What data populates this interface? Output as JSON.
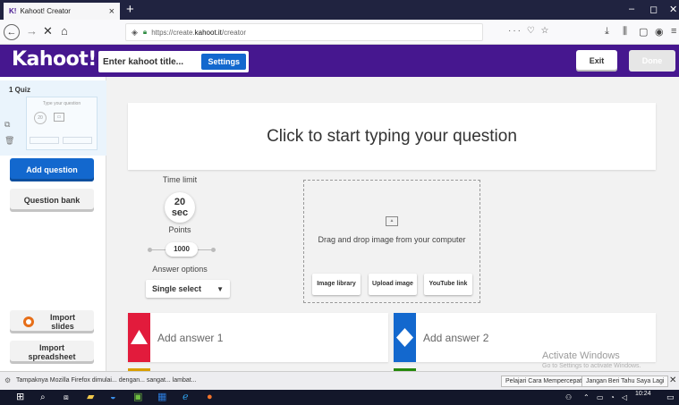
{
  "browser": {
    "tab_title": "Kahoot! Creator",
    "tab_favicon": "K!",
    "tab_close": "×",
    "new_tab": "+",
    "url_host": "https://create.",
    "url_domain": "kahoot.it",
    "url_path": "/creator",
    "page_actions": "··· ♡ ☆",
    "win_min": "‒",
    "win_max": "◻",
    "win_close": "✕"
  },
  "header": {
    "logo": "Kahoot!",
    "title_placeholder": "Enter kahoot title...",
    "settings_label": "Settings",
    "exit_label": "Exit",
    "done_label": "Done"
  },
  "sidebar": {
    "quiz_label": "1 Quiz",
    "thumb_question": "Type your question",
    "thumb_circle": "20",
    "add_question": "Add question",
    "question_bank": "Question bank",
    "import_slides": "Import slides",
    "import_spreadsheet": "Import spreadsheet"
  },
  "question": {
    "placeholder": "Click to start typing your question"
  },
  "options": {
    "time_limit_label": "Time limit",
    "time_value": "20",
    "time_unit": "sec",
    "points_label": "Points",
    "points_value": "1000",
    "answer_options_label": "Answer options",
    "answer_option_selected": "Single select"
  },
  "media": {
    "drop_text": "Drag and drop image from your computer",
    "image_library": "Image library",
    "upload_image": "Upload image",
    "youtube_link": "YouTube link"
  },
  "answers": [
    {
      "label": "Add answer 1",
      "color": "#e21b3c",
      "shape": "triangle"
    },
    {
      "label": "Add answer 2",
      "color": "#1368ce",
      "shape": "diamond"
    }
  ],
  "watermark": {
    "line1": "Activate Windows",
    "line2": "Go to Settings to activate Windows."
  },
  "notification": {
    "text": "Tampaknya Mozilla Firefox dimulai... dengan... sangat... lambat...",
    "learn_button": "Pelajari Cara Mempercepatnya",
    "dismiss_button": "Jangan Beri Tahu Saya Lagi",
    "close": "✕"
  },
  "taskbar": {
    "time": "10:24"
  },
  "colors": {
    "brand_purple": "#46178f",
    "primary_blue": "#1368ce",
    "answer_red": "#e21b3c",
    "answer_blue": "#1368ce",
    "answer_yellow": "#d89e00",
    "answer_green": "#26890c"
  }
}
